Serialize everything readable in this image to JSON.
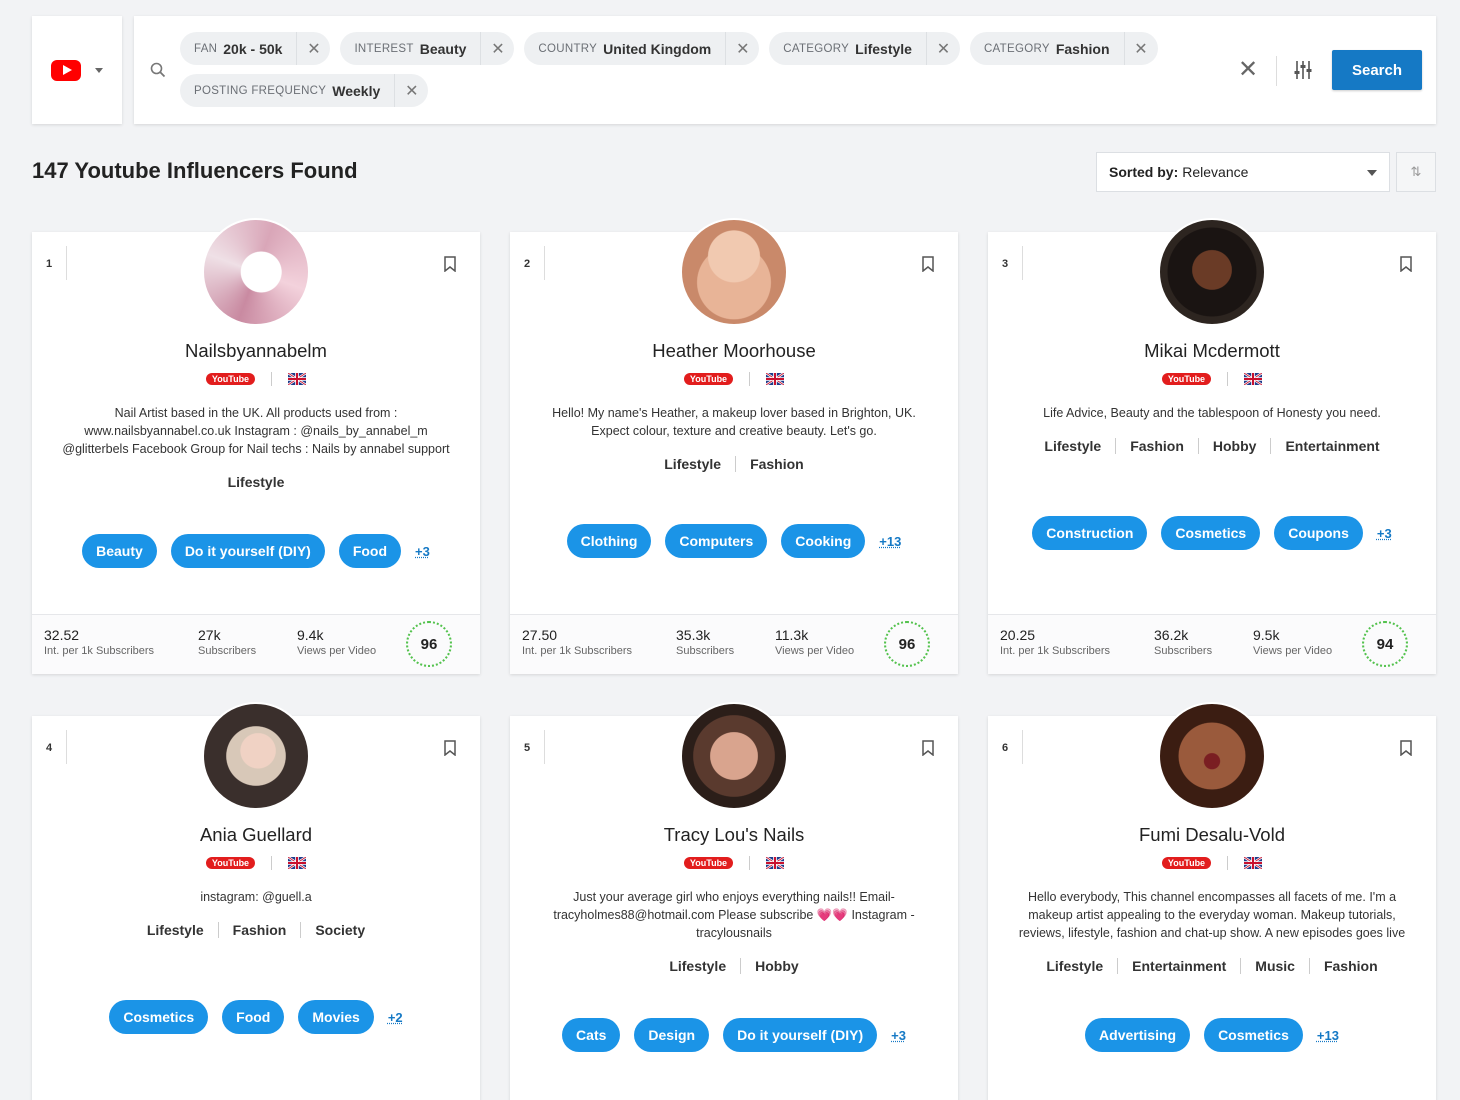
{
  "platform": {
    "icon": "youtube-logo-icon"
  },
  "filters": [
    {
      "key": "FAN",
      "value": "20k - 50k"
    },
    {
      "key": "INTEREST",
      "value": "Beauty"
    },
    {
      "key": "COUNTRY",
      "value": "United Kingdom"
    },
    {
      "key": "CATEGORY",
      "value": "Lifestyle"
    },
    {
      "key": "CATEGORY",
      "value": "Fashion"
    },
    {
      "key": "POSTING FREQUENCY",
      "value": "Weekly"
    }
  ],
  "search_button": "Search",
  "results_title": "147 Youtube Influencers Found",
  "sort": {
    "label": "Sorted by:",
    "value": "Relevance"
  },
  "stat_labels": {
    "engagement": "Int. per 1k Subscribers",
    "subscribers": "Subscribers",
    "views": "Views per Video"
  },
  "youtube_badge": "YouTube",
  "cards": [
    {
      "rank": "1",
      "name": "Nailsbyannabelm",
      "bio": "Nail Artist based in the UK. All products used from : www.nailsbyannabel.co.uk Instagram : @nails_by_annabel_m @glitterbels Facebook Group for Nail techs : Nails by annabel support",
      "categories": [
        "Lifestyle"
      ],
      "tags": [
        "Beauty",
        "Do it yourself (DIY)",
        "Food"
      ],
      "more": "+3",
      "engagement": "32.52",
      "subscribers": "27k",
      "views": "9.4k",
      "score": "96"
    },
    {
      "rank": "2",
      "name": "Heather Moorhouse",
      "bio": "Hello! My name's Heather, a makeup lover based in Brighton, UK. Expect colour, texture and creative beauty. Let's go.",
      "categories": [
        "Lifestyle",
        "Fashion"
      ],
      "tags": [
        "Clothing",
        "Computers",
        "Cooking"
      ],
      "more": "+13",
      "engagement": "27.50",
      "subscribers": "35.3k",
      "views": "11.3k",
      "score": "96"
    },
    {
      "rank": "3",
      "name": "Mikai Mcdermott",
      "bio": "Life Advice, Beauty and the tablespoon of Honesty you need.",
      "categories": [
        "Lifestyle",
        "Fashion",
        "Hobby",
        "Entertainment"
      ],
      "tags": [
        "Construction",
        "Cosmetics",
        "Coupons"
      ],
      "more": "+3",
      "engagement": "20.25",
      "subscribers": "36.2k",
      "views": "9.5k",
      "score": "94"
    },
    {
      "rank": "4",
      "name": "Ania Guellard",
      "bio": "instagram: @guell.a",
      "categories": [
        "Lifestyle",
        "Fashion",
        "Society"
      ],
      "tags": [
        "Cosmetics",
        "Food",
        "Movies"
      ],
      "more": "+2"
    },
    {
      "rank": "5",
      "name": "Tracy Lou's Nails",
      "bio": "Just your average girl who enjoys everything nails!! Email- tracyholmes88@hotmail.com Please subscribe 💗💗 Instagram - tracylousnails",
      "categories": [
        "Lifestyle",
        "Hobby"
      ],
      "tags": [
        "Cats",
        "Design",
        "Do it yourself (DIY)"
      ],
      "more": "+3"
    },
    {
      "rank": "6",
      "name": "Fumi Desalu-Vold",
      "bio": "Hello everybody, This channel encompasses all facets of me. I'm a makeup artist appealing to the everyday woman. Makeup tutorials, reviews, lifestyle, fashion and chat-up show. A new episodes goes live",
      "categories": [
        "Lifestyle",
        "Entertainment",
        "Music",
        "Fashion"
      ],
      "tags": [
        "Advertising",
        "Cosmetics"
      ],
      "more": "+13"
    }
  ]
}
